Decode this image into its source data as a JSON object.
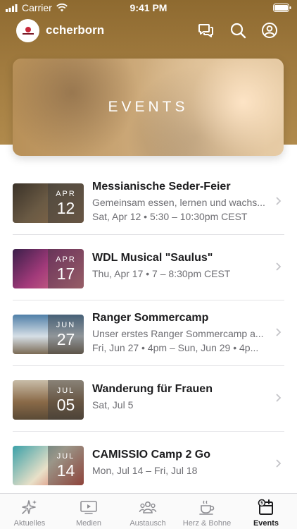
{
  "status_bar": {
    "carrier": "Carrier",
    "time": "9:41 PM"
  },
  "header": {
    "username": "ccherborn"
  },
  "hero": {
    "title": "EVENTS"
  },
  "events": [
    {
      "title": "Messianische Seder-Feier",
      "description": "Gemeinsam essen, lernen und wachs...",
      "datetime": "Sat, Apr 12 • 5:30 – 10:30pm CEST",
      "month": "APR",
      "day": "12",
      "thumb_colors": [
        "#3a3228",
        "#6a5a44",
        "#8c6b4a"
      ]
    },
    {
      "title": "WDL Musical \"Saulus\"",
      "description": "",
      "datetime": "Thu, Apr 17 • 7 – 8:30pm CEST",
      "month": "APR",
      "day": "17",
      "thumb_colors": [
        "#3b1f4a",
        "#a23a7a",
        "#e07a8a"
      ]
    },
    {
      "title": "Ranger Sommercamp",
      "description": "Unser erstes Ranger Sommercamp a...",
      "datetime": "Fri, Jun 27 • 4pm – Sun, Jun 29 • 4p...",
      "month": "JUN",
      "day": "27",
      "thumb_colors": [
        "#4f7fa8",
        "#d6dfe6",
        "#7a6a54"
      ]
    },
    {
      "title": "Wanderung für Frauen",
      "description": "",
      "datetime": "Sat, Jul 5",
      "month": "JUL",
      "day": "05",
      "thumb_colors": [
        "#c8bca8",
        "#8a6a48",
        "#5a4a36"
      ]
    },
    {
      "title": "CAMISSIO Camp 2 Go",
      "description": "",
      "datetime": "Mon, Jul 14 – Fri, Jul 18",
      "month": "JUL",
      "day": "14",
      "thumb_colors": [
        "#3aa0a8",
        "#e8e0c8",
        "#d24a3a"
      ]
    }
  ],
  "tabs": [
    {
      "label": "Aktuelles",
      "icon": "sparkle-icon",
      "active": false
    },
    {
      "label": "Medien",
      "icon": "tv-icon",
      "active": false
    },
    {
      "label": "Austausch",
      "icon": "people-icon",
      "active": false
    },
    {
      "label": "Herz & Bohne",
      "icon": "coffee-icon",
      "active": false
    },
    {
      "label": "Events",
      "icon": "calendar-icon",
      "active": true
    }
  ]
}
